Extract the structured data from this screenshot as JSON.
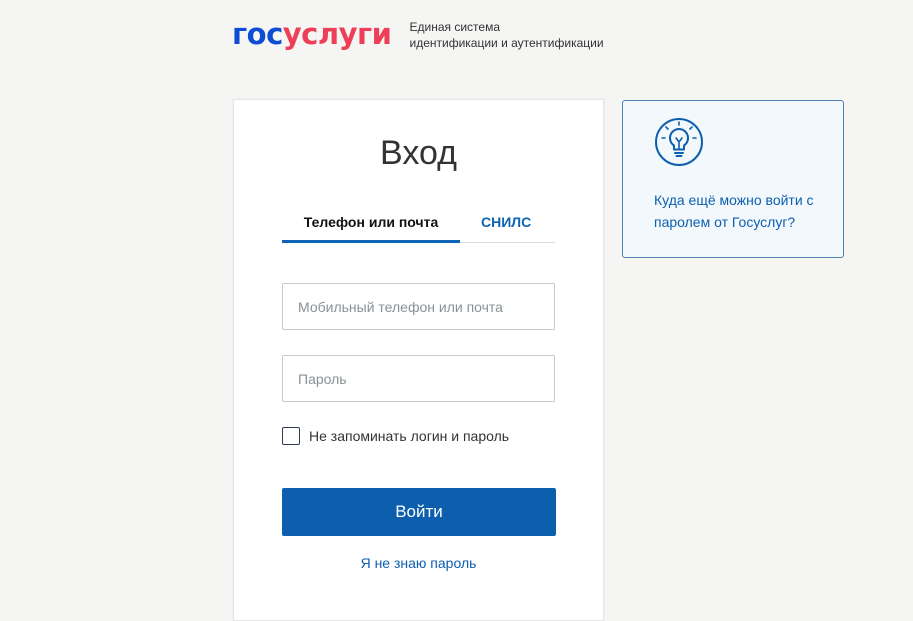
{
  "header": {
    "logo_part1": "гос",
    "logo_part2": "услуги",
    "tagline_line1": "Единая система",
    "tagline_line2": "идентификации и аутентификации"
  },
  "login": {
    "title": "Вход",
    "tabs": [
      {
        "label": "Телефон или почта",
        "active": true
      },
      {
        "label": "СНИЛС",
        "active": false
      }
    ],
    "login_placeholder": "Мобильный телефон или почта",
    "login_value": "",
    "password_placeholder": "Пароль",
    "password_value": "",
    "remember_label": "Не запоминать логин и пароль",
    "remember_checked": false,
    "submit_label": "Войти",
    "forgot_label": "Я не знаю пароль"
  },
  "info": {
    "icon": "lightbulb-icon",
    "text": "Куда ещё можно войти с паролем от Госуслуг?"
  },
  "colors": {
    "brand_blue": "#0d4cd3",
    "brand_red": "#ee3f58",
    "primary": "#0d5fae",
    "background": "#f5f5f4"
  }
}
